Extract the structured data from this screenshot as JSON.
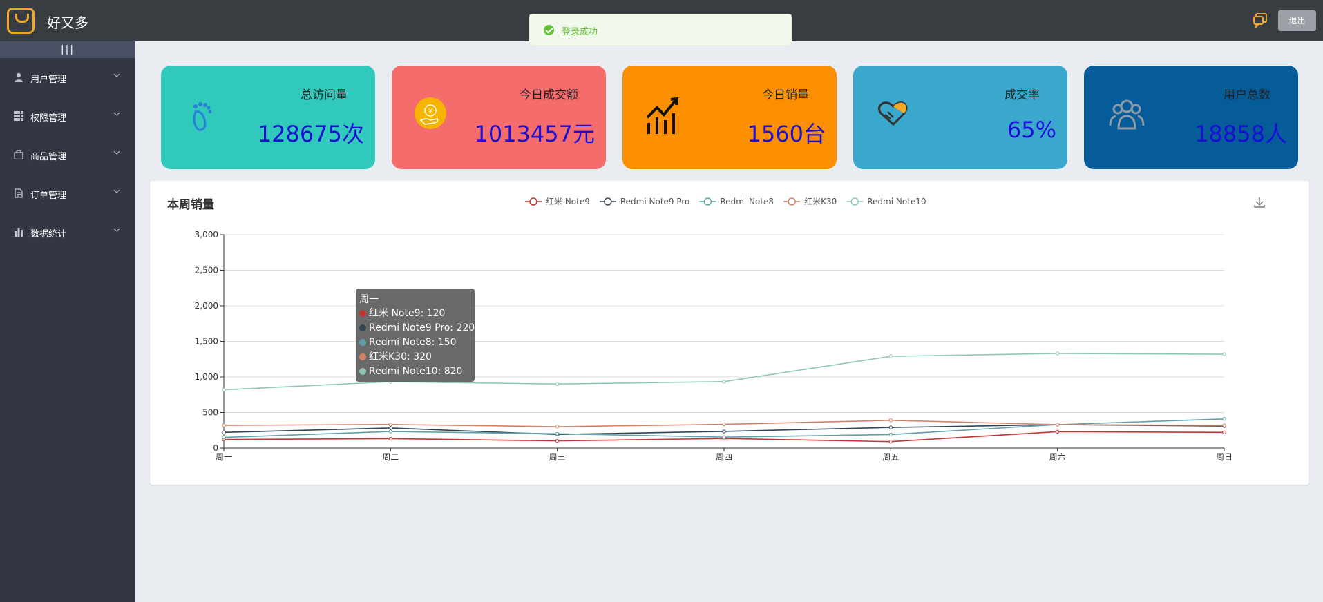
{
  "app": {
    "title": "好又多",
    "logout_label": "退出"
  },
  "toast": {
    "message": "登录成功"
  },
  "sidebar": {
    "toggle_label": "|||",
    "items": [
      {
        "label": "用户管理",
        "icon": "user-icon"
      },
      {
        "label": "权限管理",
        "icon": "grid-icon"
      },
      {
        "label": "商品管理",
        "icon": "bag-icon"
      },
      {
        "label": "订单管理",
        "icon": "document-icon"
      },
      {
        "label": "数据统计",
        "icon": "bar-chart-icon"
      }
    ]
  },
  "cards": [
    {
      "label": "总访问量",
      "value": "128675次",
      "color": "#31c9bb",
      "icon": "footprint-icon"
    },
    {
      "label": "今日成交额",
      "value": "1013457元",
      "color": "#f56c6c",
      "icon": "coin-hand-icon"
    },
    {
      "label": "今日销量",
      "value": "1560台",
      "color": "#fb8f00",
      "icon": "trend-up-icon"
    },
    {
      "label": "成交率",
      "value": "65%",
      "color": "#3aa8cc",
      "icon": "heart-handshake-icon"
    },
    {
      "label": "用户总数",
      "value": "18858人",
      "color": "#065b99",
      "icon": "users-icon"
    }
  ],
  "chart_title": "本周销量",
  "chart_data": {
    "type": "line",
    "categories": [
      "周一",
      "周二",
      "周三",
      "周四",
      "周五",
      "周六",
      "周日"
    ],
    "y_ticks": [
      "0",
      "500",
      "1,000",
      "1,500",
      "2,000",
      "2,500",
      "3,000"
    ],
    "ylim": [
      0,
      3000
    ],
    "legend_position": "top-center",
    "grid": true,
    "series": [
      {
        "name": "红米 Note9",
        "color": "#c23531",
        "values": [
          120,
          132,
          101,
          134,
          90,
          230,
          220
        ]
      },
      {
        "name": "Redmi Note9 Pro",
        "color": "#2f4554",
        "values": [
          220,
          282,
          191,
          234,
          290,
          330,
          310
        ]
      },
      {
        "name": "Redmi Note8",
        "color": "#61a0a8",
        "values": [
          150,
          232,
          201,
          154,
          190,
          330,
          410
        ]
      },
      {
        "name": "红米K30",
        "color": "#d48265",
        "values": [
          320,
          332,
          301,
          334,
          390,
          330,
          320
        ]
      },
      {
        "name": "Redmi Note10",
        "color": "#91c7ae",
        "values": [
          820,
          932,
          901,
          934,
          1290,
          1330,
          1320
        ]
      }
    ]
  },
  "tooltip": {
    "title": "周一",
    "rows": [
      {
        "text": "红米 Note9: 120",
        "color": "#c23531"
      },
      {
        "text": "Redmi Note9 Pro: 220",
        "color": "#2f4554"
      },
      {
        "text": "Redmi Note8: 150",
        "color": "#61a0a8"
      },
      {
        "text": "红米K30: 320",
        "color": "#d48265"
      },
      {
        "text": "Redmi Note10: 820",
        "color": "#91c7ae"
      }
    ]
  }
}
